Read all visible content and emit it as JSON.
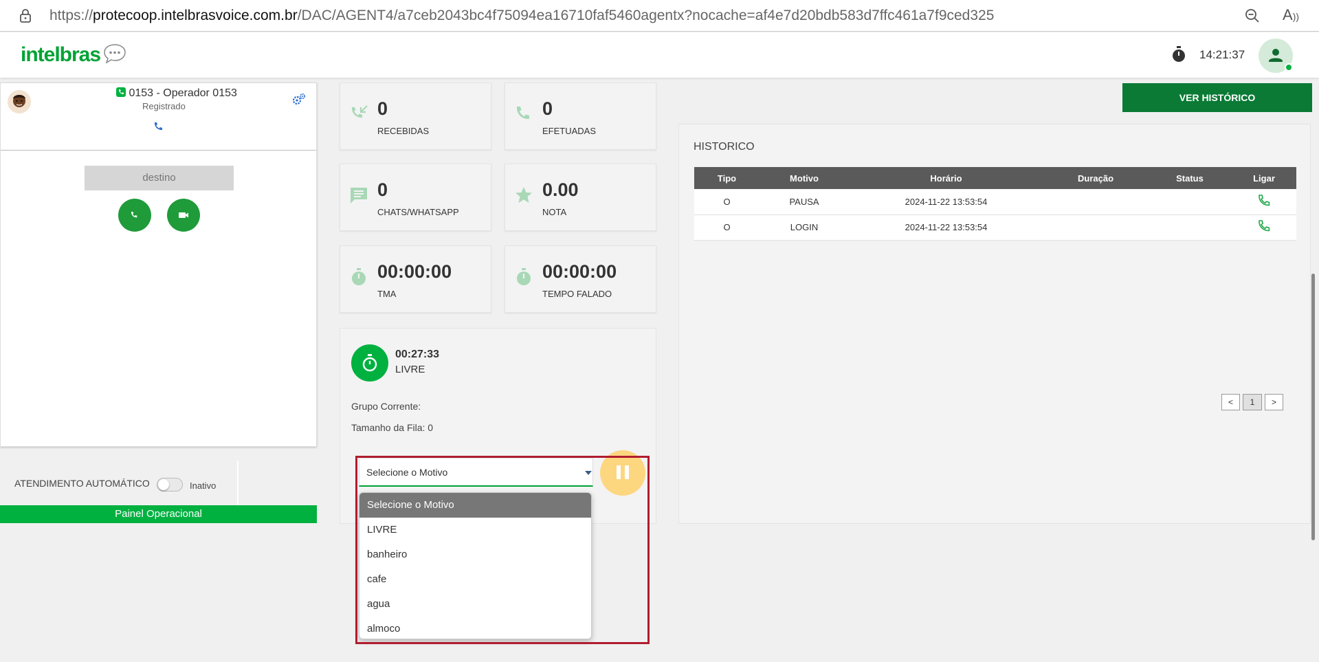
{
  "browser": {
    "url_prefix": "https://",
    "url_host": "protecoop.intelbrasvoice.com.br",
    "url_path": "/DAC/AGENT4/a7ceb2043bc4f75094ea16710faf5460agentx?nocache=af4e7d20bdb583d7ffc461a7f9ced325"
  },
  "header": {
    "logo": "intelbras",
    "clock": "14:21:37"
  },
  "phone": {
    "operator": "0153 - Operador 0153",
    "status": "Registrado",
    "destination_placeholder": "destino"
  },
  "auto_attend": {
    "label": "ATENDIMENTO AUTOMÁTICO",
    "state": "Inativo"
  },
  "footer_panel": "Painel Operacional",
  "stats": [
    {
      "value": "0",
      "label": "RECEBIDAS",
      "icon": "call-received-icon"
    },
    {
      "value": "0",
      "label": "EFETUADAS",
      "icon": "phone-icon"
    },
    {
      "value": "0",
      "label": "CHATS/WHATSAPP",
      "icon": "chat-icon"
    },
    {
      "value": "0.00",
      "label": "NOTA",
      "icon": "star-icon"
    },
    {
      "value": "00:00:00",
      "label": "TMA",
      "icon": "timer-icon"
    },
    {
      "value": "00:00:00",
      "label": "TEMPO FALADO",
      "icon": "timer-icon"
    }
  ],
  "status_card": {
    "time": "00:27:33",
    "state": "LIVRE",
    "grupo": "Grupo Corrente:",
    "fila": "Tamanho da Fila: 0"
  },
  "motivo": {
    "selected": "Selecione o Motivo",
    "options": [
      "Selecione o Motivo",
      "LIVRE",
      "banheiro",
      "cafe",
      "agua",
      "almoco"
    ]
  },
  "historico": {
    "button": "VER HISTÓRICO",
    "title": "HISTORICO",
    "columns": [
      "Tipo",
      "Motivo",
      "Horário",
      "Duração",
      "Status",
      "Ligar"
    ],
    "rows": [
      [
        "O",
        "PAUSA",
        "2024-11-22 13:53:54",
        "",
        ""
      ],
      [
        "O",
        "LOGIN",
        "2024-11-22 13:53:54",
        "",
        ""
      ]
    ],
    "pager": [
      "<",
      "1",
      ">"
    ]
  },
  "colors": {
    "brand_green": "#00a335",
    "dark_green": "#0a7a35",
    "highlight_red": "#b01c2e",
    "pause_yellow": "#fdd680"
  }
}
